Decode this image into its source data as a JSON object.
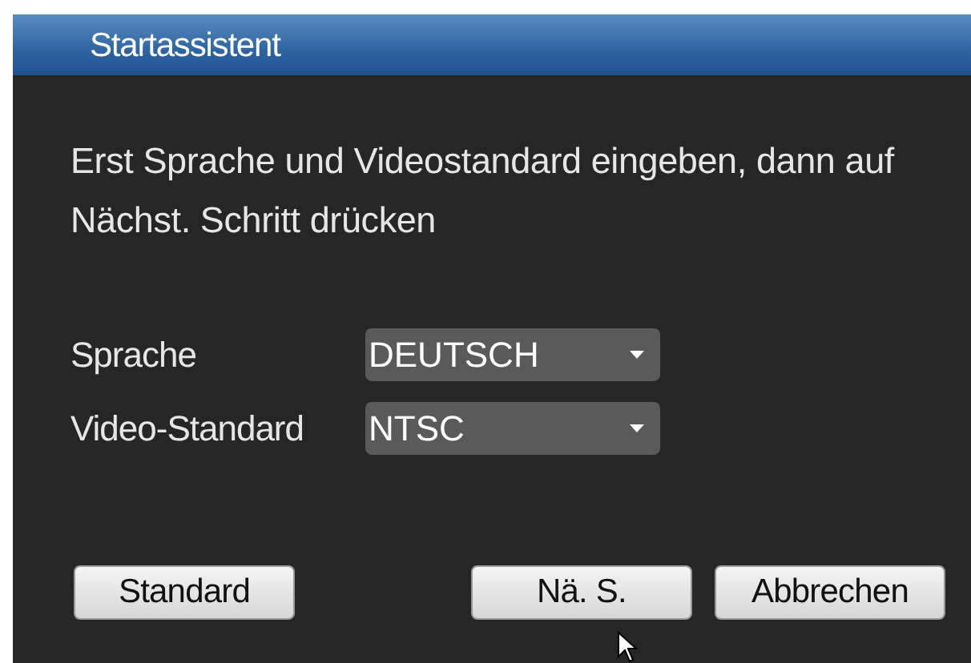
{
  "window": {
    "title": "Startassistent"
  },
  "instruction": "Erst Sprache und Videostandard eingeben, dann auf Nächst. Schritt drücken",
  "fields": [
    {
      "label": "Sprache",
      "value": "DEUTSCH"
    },
    {
      "label": "Video-Standard",
      "value": "NTSC"
    }
  ],
  "buttons_left": [
    "Standard"
  ],
  "buttons_right": [
    "Nä. S.",
    "Abbrechen"
  ]
}
